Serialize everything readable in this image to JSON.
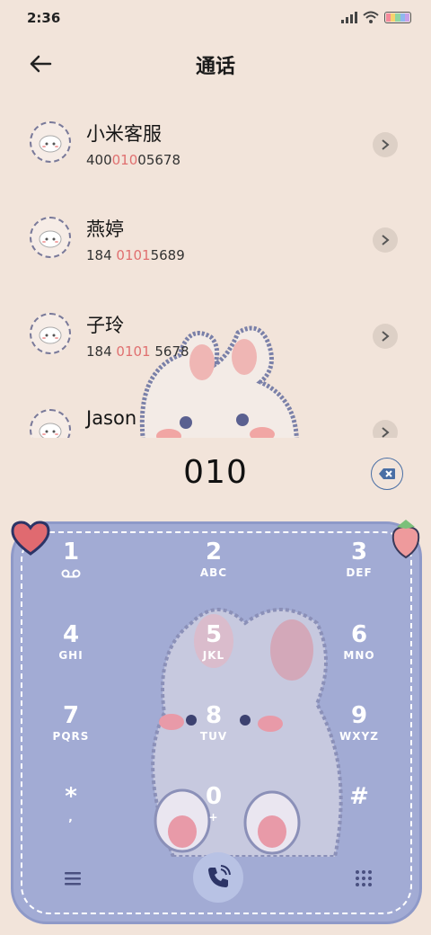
{
  "status": {
    "time": "2:36"
  },
  "header": {
    "title": "通话"
  },
  "contacts": [
    {
      "name": "小米客服",
      "num_pre": "400",
      "num_hl": "010",
      "num_post": "05678"
    },
    {
      "name": "燕婷",
      "num_pre": "184 ",
      "num_hl": "0101",
      "num_post": "5689"
    },
    {
      "name": "子玲",
      "num_pre": "184 ",
      "num_hl": "0101",
      "num_post": " 5678"
    },
    {
      "name": "Jason",
      "num_pre": "",
      "num_hl": "",
      "num_post": ""
    }
  ],
  "dial": {
    "number": "010"
  },
  "keypad": {
    "keys": [
      {
        "digit": "1",
        "letters": ""
      },
      {
        "digit": "2",
        "letters": "ABC"
      },
      {
        "digit": "3",
        "letters": "DEF"
      },
      {
        "digit": "4",
        "letters": "GHI"
      },
      {
        "digit": "5",
        "letters": "JKL"
      },
      {
        "digit": "6",
        "letters": "MNO"
      },
      {
        "digit": "7",
        "letters": "PQRS"
      },
      {
        "digit": "8",
        "letters": "TUV"
      },
      {
        "digit": "9",
        "letters": "WXYZ"
      },
      {
        "digit": "*",
        "letters": ","
      },
      {
        "digit": "0",
        "letters": "+"
      },
      {
        "digit": "#",
        "letters": ""
      }
    ]
  },
  "icons": {
    "back": "arrow-left-icon",
    "backspace": "backspace-icon",
    "voicemail": "voicemail-icon",
    "menu": "menu-icon",
    "call": "phone-call-icon",
    "dialpad": "dialpad-icon"
  },
  "colors": {
    "background": "#f2e4da",
    "keypad": "#a2abd4",
    "highlight": "#e07070",
    "accent": "#4a6fa5"
  }
}
